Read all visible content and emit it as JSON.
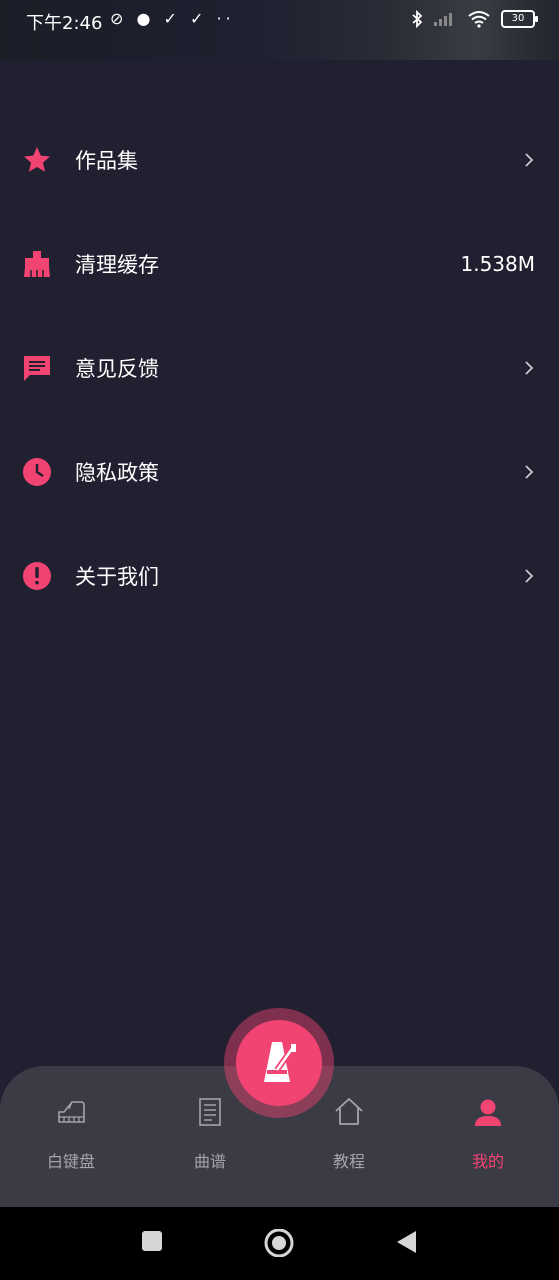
{
  "status_bar": {
    "time": "下午2:46",
    "left_icons": "⊘ ● ✓ ✓ ··",
    "battery": "30"
  },
  "menu": {
    "items": [
      {
        "label": "作品集",
        "icon": "star-icon",
        "trailing": "chevron"
      },
      {
        "label": "清理缓存",
        "icon": "broom-icon",
        "trailing": "value",
        "value": "1.538M"
      },
      {
        "label": "意见反馈",
        "icon": "chat-icon",
        "trailing": "chevron"
      },
      {
        "label": "隐私政策",
        "icon": "clock-icon",
        "trailing": "chevron"
      },
      {
        "label": "关于我们",
        "icon": "alert-icon",
        "trailing": "chevron"
      }
    ]
  },
  "bottom_nav": {
    "items": [
      {
        "label": "白键盘",
        "icon": "piano-icon",
        "active": false
      },
      {
        "label": "曲谱",
        "icon": "sheet-music-icon",
        "active": false
      },
      {
        "label": "教程",
        "icon": "home-icon",
        "active": false
      },
      {
        "label": "我的",
        "icon": "person-icon",
        "active": true
      }
    ],
    "center_button_icon": "metronome-icon"
  },
  "colors": {
    "accent": "#f24473",
    "background": "#202030",
    "nav_bg": "#3b3b45",
    "nav_inactive": "#a3a3ad"
  }
}
